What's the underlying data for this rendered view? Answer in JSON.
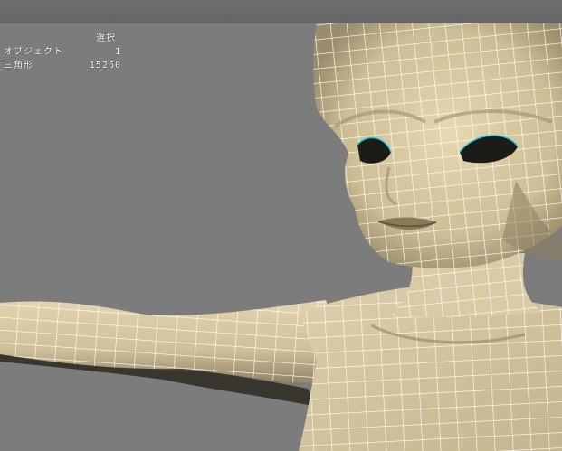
{
  "hud": {
    "heading": "選択",
    "rows": [
      {
        "label": "オブジェクト",
        "value": "1"
      },
      {
        "label": "三角形",
        "value": "15260"
      }
    ]
  },
  "colors": {
    "background": "#7c7c7c",
    "skin": "#d8c9a2",
    "wire": "#ffffff",
    "selection": "#1fd0e0"
  }
}
